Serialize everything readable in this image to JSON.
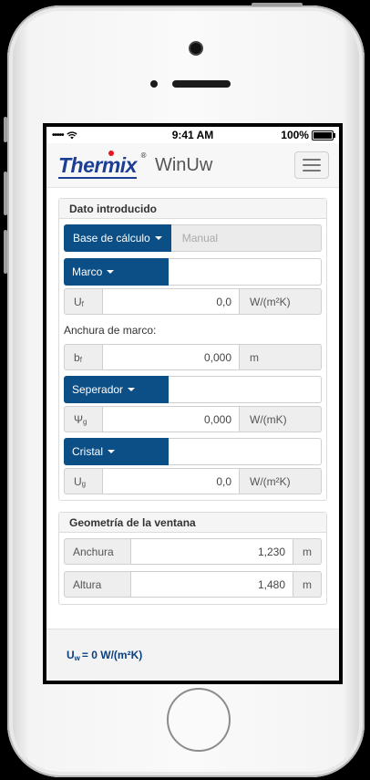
{
  "status_bar": {
    "signal": "•••••",
    "wifi_icon": "wifi-icon",
    "time": "9:41 AM",
    "battery": "100%"
  },
  "header": {
    "logo": {
      "text": "Thermix",
      "registered": "®"
    },
    "app_name": "WinUw",
    "menu_icon": "hamburger-icon"
  },
  "dato": {
    "heading": "Dato introducido",
    "mode_active": "Base de cálculo",
    "mode_inactive": "Manual",
    "marco": {
      "dropdown": "Marco",
      "symbol": "U",
      "sub": "f",
      "value": "0,0",
      "unit": "W/(m²K)"
    },
    "anchura_label": "Anchura de marco:",
    "bf": {
      "symbol": "b",
      "sub": "f",
      "value": "0,000",
      "unit": "m"
    },
    "separador": {
      "dropdown": "Seperador",
      "symbol": "Ψ",
      "sub": "g",
      "value": "0,000",
      "unit": "W/(mK)"
    },
    "cristal": {
      "dropdown": "Cristal",
      "symbol": "U",
      "sub": "g",
      "value": "0,0",
      "unit": "W/(m²K)"
    }
  },
  "geometria": {
    "heading": "Geometría de la ventana",
    "anchura": {
      "label": "Anchura",
      "value": "1,230",
      "unit": "m"
    },
    "altura": {
      "label": "Altura",
      "value": "1,480",
      "unit": "m"
    }
  },
  "result": {
    "symbol": "U",
    "sub": "w",
    "text": "= 0 W/(m²K)"
  },
  "colors": {
    "primary": "#0c4f86",
    "logo_blue": "#1c3f94",
    "logo_red": "#e4161e"
  }
}
